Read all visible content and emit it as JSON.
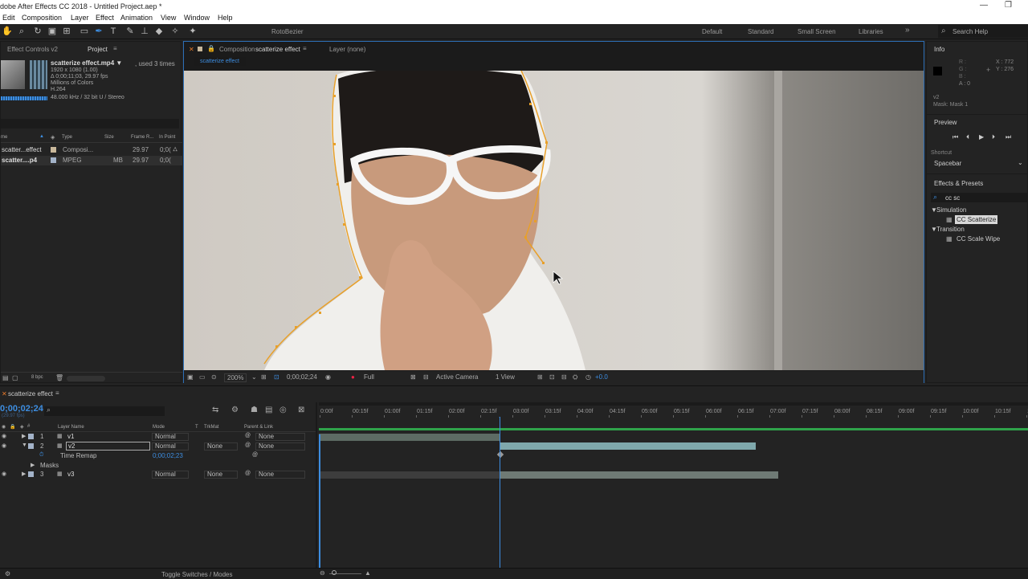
{
  "window": {
    "title": "dobe After Effects CC 2018 - Untitled Project.aep *",
    "min": "—",
    "max": "❐"
  },
  "menu": [
    "Edit",
    "Composition",
    "Layer",
    "Effect",
    "Animation",
    "View",
    "Window",
    "Help"
  ],
  "toolbar": {
    "rotobezier": "RotoBezier",
    "workspaces": [
      "Default",
      "Standard",
      "Small Screen",
      "Libraries"
    ],
    "more": "»",
    "search_placeholder": "Search Help"
  },
  "project": {
    "tab_effect_controls": "Effect Controls v2",
    "tab_project": "Project",
    "tab_menu": "≡",
    "asset_name": "scatterize effect.mp4 ▼",
    "used": ", used 3 times",
    "info": [
      "1920 x 1080 (1.00)",
      "Δ 0;00;11;03, 29.97 fps",
      "Millions of Colors",
      "H.264",
      "48.000 kHz / 32 bit U / Stereo"
    ],
    "columns": [
      "me",
      "Type",
      "Size",
      "Frame R...",
      "In Point"
    ],
    "rows": [
      {
        "name": "scatter...effect",
        "type": "Composi...",
        "size": "",
        "fps": "29.97",
        "in": "0;0("
      },
      {
        "name": "scatter....p4",
        "type": "MPEG",
        "size": "MB",
        "fps": "29.97",
        "in": "0;0("
      }
    ],
    "bpc": "8 bpc"
  },
  "viewer": {
    "tab_comp": "Composition",
    "comp_name": "scatterize effect",
    "tab_menu": "≡",
    "tab_layer": "Layer (none)",
    "crumb": "scatterize effect",
    "zoom": "200%",
    "timecode": "0;00;02;24",
    "resolution": "Full",
    "camera": "Active Camera",
    "views": "1 View",
    "exposure": "+0.0"
  },
  "info_panel": {
    "title": "Info",
    "rgba": [
      "R :",
      "G :",
      "B :",
      "A : 0"
    ],
    "x": "X : 772",
    "y": "Y : 276",
    "layer": "v2",
    "mask": "Mask: Mask 1"
  },
  "preview": {
    "title": "Preview",
    "shortcut_label": "Shortcut",
    "shortcut": "Spacebar"
  },
  "effects": {
    "title": "Effects & Presets",
    "query": "cc sc",
    "groups": [
      {
        "name": "Simulation",
        "item": "CC Scatterize"
      },
      {
        "name": "Transition",
        "item": "CC Scale Wipe"
      }
    ]
  },
  "timeline": {
    "tab": "scatterize effect",
    "tab_menu": "≡",
    "timecode": "0;00;02;24",
    "fps": "(29.97 fps)",
    "headers": {
      "name": "Layer Name",
      "mode": "Mode",
      "t": "T",
      "trkmat": "TrkMat",
      "parent": "Parent & Link"
    },
    "layers": [
      {
        "num": "1",
        "name": "v1",
        "mode": "Normal",
        "trkmat": "",
        "parent": "None"
      },
      {
        "num": "2",
        "name": "v2",
        "mode": "Normal",
        "trkmat": "None",
        "parent": "None"
      },
      {
        "num": "3",
        "name": "v3",
        "mode": "Normal",
        "trkmat": "None",
        "parent": "None"
      }
    ],
    "time_remap_label": "Time Remap",
    "time_remap_value": "0;00;02;23",
    "masks_label": "Masks",
    "ruler": [
      "0:00f",
      "00:15f",
      "01:00f",
      "01:15f",
      "02:00f",
      "02:15f",
      "03:00f",
      "03:15f",
      "04:00f",
      "04:15f",
      "05:00f",
      "05:15f",
      "06:00f",
      "06:15f",
      "07:00f",
      "07:15f",
      "08:00f",
      "08:15f",
      "09:00f",
      "09:15f",
      "10:00f",
      "10:15f",
      "11:0"
    ],
    "toggle": "Toggle Switches / Modes"
  },
  "colors": {
    "accent": "#3d8de0",
    "mask": "#e8a02a",
    "bar_v2": "#7fa8ac",
    "bar_v1": "#5d6b64",
    "work_area": "#2fa34a"
  }
}
